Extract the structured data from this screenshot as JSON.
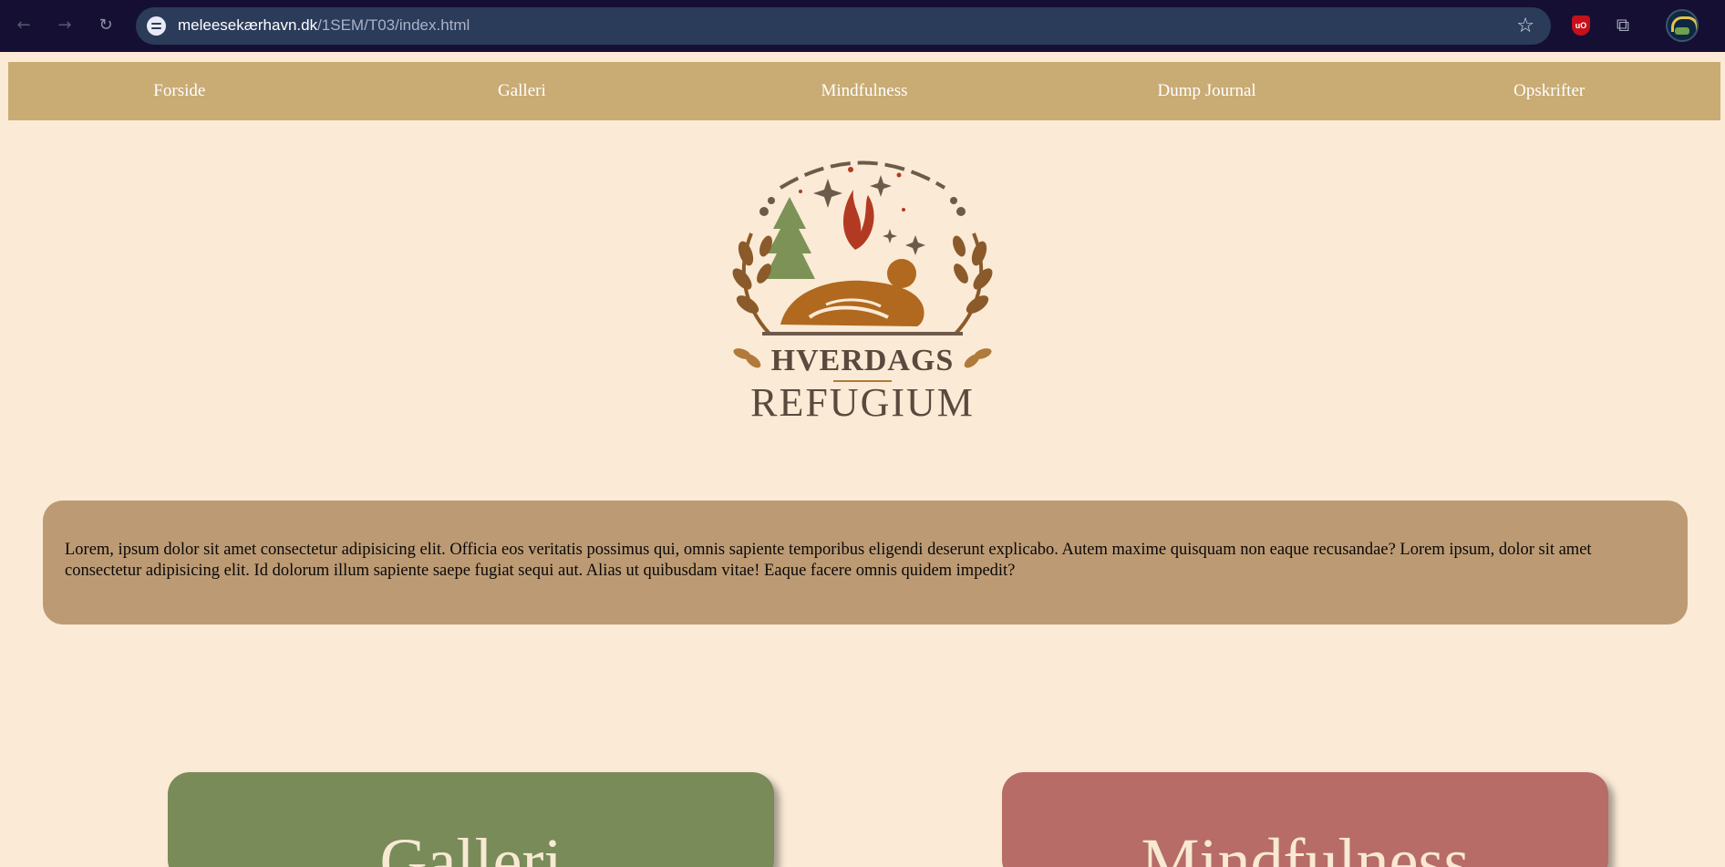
{
  "browser": {
    "url_host": "meleesekærhavn.dk",
    "url_path": "/1SEM/T03/index.html",
    "icons": [
      "back-icon",
      "forward-icon",
      "reload-icon",
      "site-info-icon",
      "bookmark-star-icon",
      "ublock-icon",
      "extensions-icon",
      "profile-avatar",
      "menu-icon"
    ]
  },
  "nav": {
    "items": [
      {
        "label": "Forside"
      },
      {
        "label": "Galleri"
      },
      {
        "label": "Mindfulness"
      },
      {
        "label": "Dump Journal"
      },
      {
        "label": "Opskrifter"
      }
    ]
  },
  "logo": {
    "line1": "HVERDAGS",
    "line2": "REFUGIUM"
  },
  "intro": {
    "text": "Lorem, ipsum dolor sit amet consectetur adipisicing elit. Officia eos veritatis possimus qui, omnis sapiente temporibus eligendi deserunt explicabo. Autem maxime quisquam non eaque recusandae? Lorem ipsum, dolor sit amet consectetur adipisicing elit. Id dolorum illum sapiente saepe fugiat sequi aut. Alias ut quibusdam vitae! Eaque facere omnis quidem impedit?"
  },
  "cards": [
    {
      "title": "Galleri",
      "color": "#788b58"
    },
    {
      "title": "Mindfulness",
      "color": "#b76c67"
    }
  ],
  "colors": {
    "background": "#fbead6",
    "nav": "#c9ab74",
    "intro_box": "#bc9b74"
  }
}
